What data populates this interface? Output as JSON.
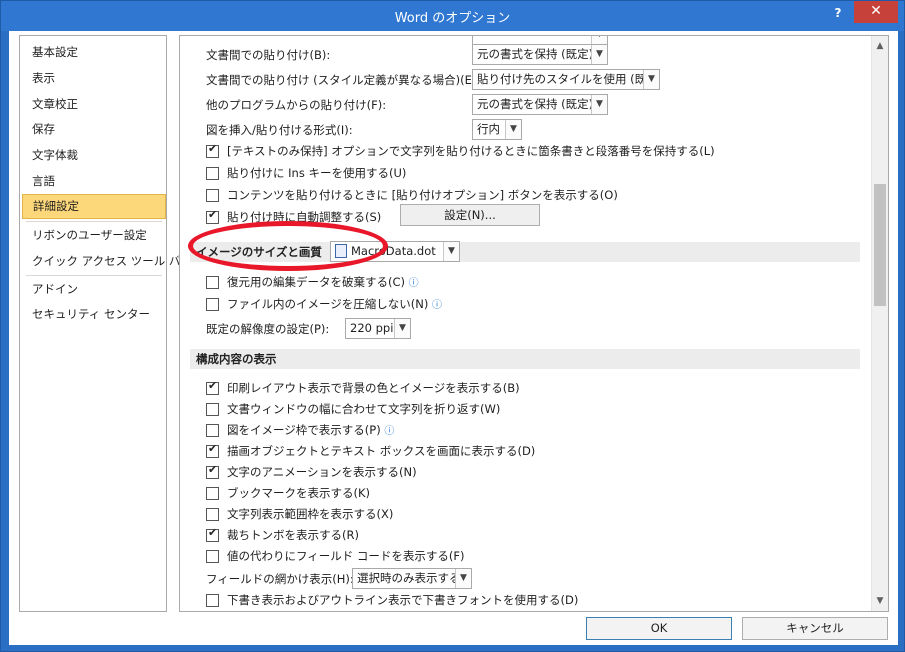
{
  "window": {
    "title": "Word のオプション",
    "help_label": "?",
    "close_label": "✕"
  },
  "sidebar": {
    "items": [
      {
        "label": "基本設定"
      },
      {
        "label": "表示"
      },
      {
        "label": "文章校正"
      },
      {
        "label": "保存"
      },
      {
        "label": "文字体裁"
      },
      {
        "label": "言語"
      },
      {
        "label": "詳細設定",
        "selected": true
      },
      {
        "label": "リボンのユーザー設定"
      },
      {
        "label": "クイック アクセス ツール バー"
      },
      {
        "label": "アドイン"
      },
      {
        "label": "セキュリティ センター"
      }
    ]
  },
  "paste": {
    "rows": [
      {
        "label": "文書間での貼り付け(B):",
        "value": "元の書式を保持 (既定)"
      },
      {
        "label": "文書間での貼り付け (スタイル定義が異なる場合)(E):",
        "value": "貼り付け先のスタイルを使用 (既定)"
      },
      {
        "label": "他のプログラムからの貼り付け(F):",
        "value": "元の書式を保持 (既定)"
      },
      {
        "label": "図を挿入/貼り付ける形式(I):",
        "value": "行内"
      }
    ],
    "checks": [
      {
        "label": "[テキストのみ保持] オプションで文字列を貼り付けるときに箇条書きと段落番号を保持する(L)",
        "checked": true
      },
      {
        "label": "貼り付けに Ins キーを使用する(U)",
        "checked": false
      },
      {
        "label": "コンテンツを貼り付けるときに [貼り付けオプション] ボタンを表示する(O)",
        "checked": false
      },
      {
        "label": "貼り付け時に自動調整する(S)",
        "checked": true
      }
    ],
    "settings_button": "設定(N)..."
  },
  "image": {
    "header": "イメージのサイズと画質",
    "doc_select": "MacroData.dot",
    "checks": [
      {
        "label": "復元用の編集データを破棄する(C)",
        "checked": false,
        "info": true
      },
      {
        "label": "ファイル内のイメージを圧縮しない(N)",
        "checked": false,
        "info": true
      }
    ],
    "resolution_label": "既定の解像度の設定(P):",
    "resolution_value": "220 ppi"
  },
  "display": {
    "header": "構成内容の表示",
    "checks": [
      {
        "label": "印刷レイアウト表示で背景の色とイメージを表示する(B)",
        "checked": true
      },
      {
        "label": "文書ウィンドウの幅に合わせて文字列を折り返す(W)",
        "checked": false
      },
      {
        "label": "図をイメージ枠で表示する(P)",
        "checked": false,
        "info": true
      },
      {
        "label": "描画オブジェクトとテキスト ボックスを画面に表示する(D)",
        "checked": true
      },
      {
        "label": "文字のアニメーションを表示する(N)",
        "checked": true
      },
      {
        "label": "ブックマークを表示する(K)",
        "checked": false
      },
      {
        "label": "文字列表示範囲枠を表示する(X)",
        "checked": false
      },
      {
        "label": "裁ちトンボを表示する(R)",
        "checked": true
      },
      {
        "label": "値の代わりにフィールド コードを表示する(F)",
        "checked": false
      }
    ],
    "shading_label": "フィールドの網かけ表示(H):",
    "shading_value": "選択時のみ表示する",
    "draft_check": {
      "label": "下書き表示およびアウトライン表示で下書きフォントを使用する(D)",
      "checked": false
    }
  },
  "buttons": {
    "ok": "OK",
    "cancel": "キャンセル"
  },
  "colors": {
    "titlebar": "#2f77d0",
    "close": "#c7413b",
    "selected_nav": "#fcd87a",
    "annotation": "#e8172a",
    "info": "#2d7bd8"
  },
  "icons": {
    "dropdown": "chevron-down-icon",
    "info": "info-icon",
    "document": "document-icon"
  }
}
